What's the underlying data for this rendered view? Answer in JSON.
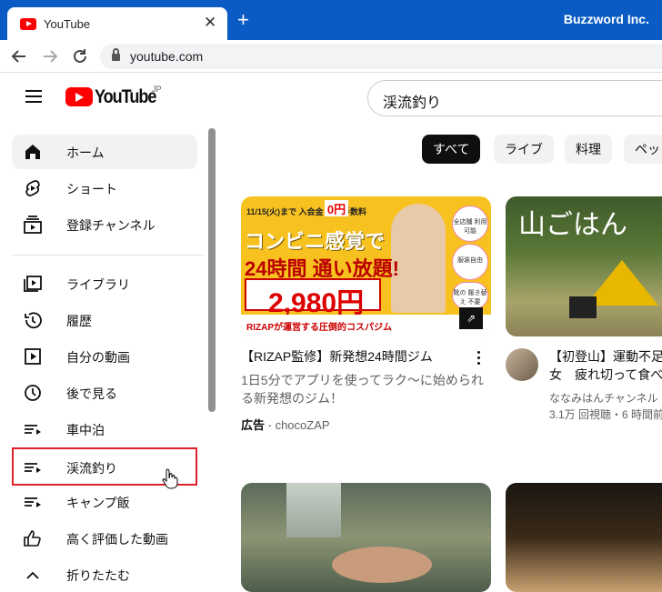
{
  "browser": {
    "tab_title": "YouTube",
    "tab_close": "✕",
    "new_tab": "+",
    "profile": "Buzzword Inc.",
    "url": "youtube.com"
  },
  "header": {
    "wordmark": "YouTube",
    "country": "JP",
    "search_value": "渓流釣り"
  },
  "sidebar": {
    "items": [
      {
        "label": "ホーム",
        "icon": "home-icon"
      },
      {
        "label": "ショート",
        "icon": "shorts-icon"
      },
      {
        "label": "登録チャンネル",
        "icon": "subscriptions-icon"
      },
      {
        "label": "ライブラリ",
        "icon": "library-icon"
      },
      {
        "label": "履歴",
        "icon": "history-icon"
      },
      {
        "label": "自分の動画",
        "icon": "your-videos-icon"
      },
      {
        "label": "後で見る",
        "icon": "watch-later-icon"
      },
      {
        "label": "車中泊",
        "icon": "playlist-icon"
      },
      {
        "label": "渓流釣り",
        "icon": "playlist-icon"
      },
      {
        "label": "キャンプ飯",
        "icon": "playlist-icon"
      },
      {
        "label": "高く評価した動画",
        "icon": "thumbs-up-icon"
      },
      {
        "label": "折りたたむ",
        "icon": "chevron-up-icon"
      }
    ]
  },
  "chips": [
    "すべて",
    "ライブ",
    "料理",
    "ペッ"
  ],
  "cards": {
    "ad": {
      "thumb_line1": "11/15(火)まで 入会金 事務手数料",
      "thumb_zero": "0円",
      "thumb_big1": "コンビニ感覚で",
      "thumb_big2": "24時間 通い放題!",
      "thumb_price": "2,980円",
      "thumb_bottom": "RIZAPが運営する圧倒的コスパジム",
      "badge1": "全店舗 利用可能",
      "badge2": "服装自由",
      "badge3": "靴の 履き替え 不要",
      "title": "【RIZAP監修】新発想24時間ジム",
      "desc1": "1日5分でアプリを使ってラク〜に始められ",
      "desc2": "る新発想のジム！",
      "ad_tag": "広告",
      "ad_sep": " · ",
      "channel": "chocoZAP"
    },
    "mountain": {
      "thumb_text": "山ごはん",
      "title1": "【初登山】運動不足",
      "title2": "女　疲れ切って食べ",
      "channel": "ななみはんチャンネル",
      "meta": "3.1万 回視聴・6 時間前"
    }
  }
}
